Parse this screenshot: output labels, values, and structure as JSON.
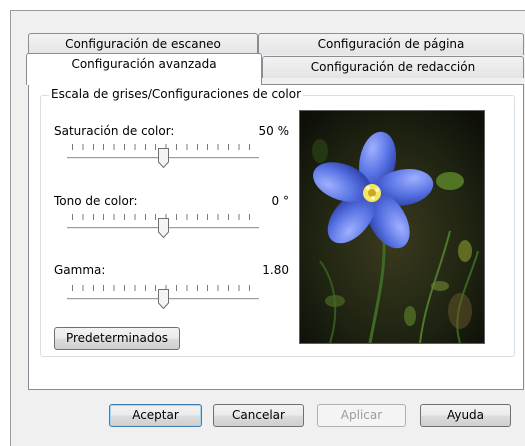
{
  "tabs": {
    "scan": "Configuración de escaneo",
    "page": "Configuración de página",
    "advanced": "Configuración avanzada",
    "redaction": "Configuración de redacción"
  },
  "group": {
    "legend": "Escala de grises/Configuraciones de color"
  },
  "sliders": [
    {
      "label": "Saturación de color:",
      "value_text": "50 %",
      "value": 0.5
    },
    {
      "label": "Tono de color:",
      "value_text": "0 °",
      "value": 0.5
    },
    {
      "label": "Gamma:",
      "value_text": "1.80",
      "value": 0.5
    }
  ],
  "defaults_button": "Predeterminados",
  "buttons": {
    "accept": "Aceptar",
    "cancel": "Cancelar",
    "apply": "Aplicar",
    "help": "Ayuda"
  },
  "colors": {
    "accent": "#3c7fb1",
    "flower": "#4a63d6"
  },
  "icons": {
    "preview": "flower-preview-image"
  }
}
